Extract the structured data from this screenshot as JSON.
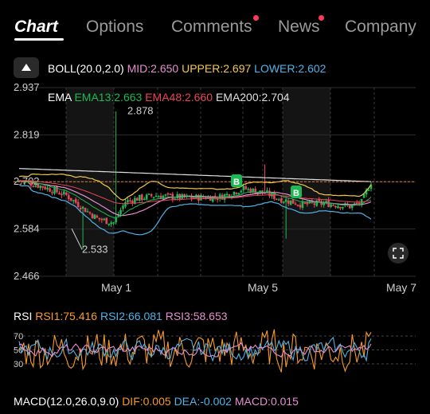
{
  "tabs": [
    {
      "label": "Chart",
      "active": true
    },
    {
      "label": "Options"
    },
    {
      "label": "Comments",
      "dot": true
    },
    {
      "label": "News",
      "dot": true
    },
    {
      "label": "Company"
    }
  ],
  "indicators": {
    "boll": {
      "name": "BOLL(20.0,2.0)",
      "mid": "MID:2.650",
      "upper": "UPPER:2.697",
      "lower": "LOWER:2.602"
    },
    "ema": {
      "name": "EMA",
      "ema13": "EMA13:2.663",
      "ema48": "EMA48:2.660",
      "ema200": "EMA200:2.704"
    },
    "rsi": {
      "name": "RSI",
      "rsi1": "RSI1:75.416",
      "rsi2": "RSI2:66.081",
      "rsi3": "RSI3:58.653"
    },
    "macd": {
      "name": "MACD(12.0,26.0,9.0)",
      "dif": "DIF:0.005",
      "dea": "DEA:-0.002",
      "macd": "MACD:0.015"
    }
  },
  "colors": {
    "up": "#1db954",
    "down": "#e8455a",
    "mid": "#e58fd0",
    "upper": "#f2c94c",
    "lower": "#4fb3e8",
    "ema13": "#1db954",
    "ema48": "#e8455a",
    "ema200": "#e0e0e0",
    "rsi1": "#f79a2b",
    "rsi2": "#4fb3e8",
    "rsi3": "#e58fd0"
  },
  "chart_data": {
    "type": "candlestick",
    "y_ticks": [
      "2.937",
      "2.819",
      "2.702",
      "2.584",
      "2.466"
    ],
    "ylim": [
      2.466,
      2.937
    ],
    "x_ticks": [
      "May 1",
      "May 5",
      "May 7"
    ],
    "annotations": {
      "high": "2.878",
      "low": "2.533"
    },
    "last_price": 2.702,
    "buy_markers": [
      "B",
      "B"
    ],
    "rsi_ticks": [
      "70",
      "50",
      "30"
    ]
  }
}
